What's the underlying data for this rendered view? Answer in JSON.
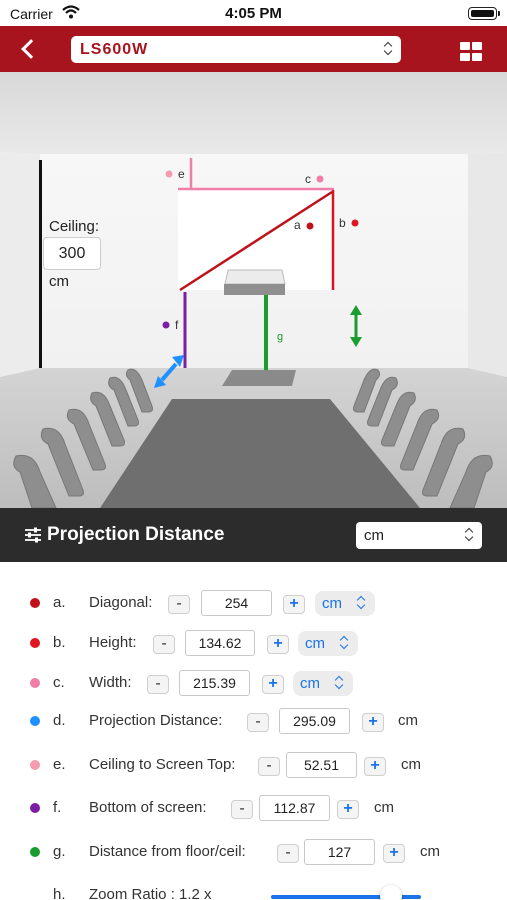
{
  "status_bar": {
    "carrier": "Carrier",
    "time": "4:05 PM"
  },
  "nav": {
    "model": "LS600W"
  },
  "room": {
    "ceiling_label": "Ceiling:",
    "ceiling_value": "300",
    "ceiling_unit": "cm",
    "labels": {
      "a": "a",
      "b": "b",
      "c": "c",
      "e": "e",
      "f": "f",
      "g": "g"
    }
  },
  "panel": {
    "title": "Projection Distance",
    "unit": "cm"
  },
  "rows": [
    {
      "letter": "a.",
      "label": "Diagonal:",
      "value": "254",
      "unit": "cm",
      "color": "#c0111b"
    },
    {
      "letter": "b.",
      "label": "Height:",
      "value": "134.62",
      "unit": "cm",
      "color": "#e0151f"
    },
    {
      "letter": "c.",
      "label": "Width:",
      "value": "215.39",
      "unit": "cm",
      "color": "#f07ea8"
    },
    {
      "letter": "d.",
      "label": "Projection Distance:",
      "value": "295.09",
      "unit": "cm",
      "color": "#1e90ff"
    },
    {
      "letter": "e.",
      "label": "Ceiling to Screen Top:",
      "value": "52.51",
      "unit": "cm",
      "color": "#f49bb0"
    },
    {
      "letter": "f.",
      "label": "Bottom of screen:",
      "value": "112.87",
      "unit": "cm",
      "color": "#7b1fa2"
    },
    {
      "letter": "g.",
      "label": "Distance from floor/ceil:",
      "value": "127",
      "unit": "cm",
      "color": "#1a9c2e"
    },
    {
      "letter": "h.",
      "label": "Zoom Ratio : 1.2 x"
    }
  ],
  "zoom_slider": {
    "level": 0.8
  },
  "icons": {
    "back": "back-chevron-icon",
    "menu": "grid-menu-icon",
    "settings": "sliders-icon",
    "wifi": "wifi-icon",
    "battery": "battery-icon"
  }
}
